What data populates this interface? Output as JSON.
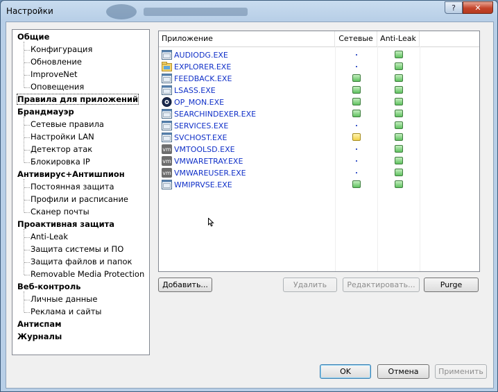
{
  "window": {
    "title": "Настройки"
  },
  "tree": {
    "items": [
      {
        "label": "Общие",
        "kind": "cat"
      },
      {
        "label": "Конфигурация",
        "kind": "sub"
      },
      {
        "label": "Обновление",
        "kind": "sub"
      },
      {
        "label": "ImproveNet",
        "kind": "sub"
      },
      {
        "label": "Оповещения",
        "kind": "sub"
      },
      {
        "label": "Правила для приложений",
        "kind": "cat",
        "selected": true
      },
      {
        "label": "Брандмауэр",
        "kind": "cat"
      },
      {
        "label": "Сетевые правила",
        "kind": "sub"
      },
      {
        "label": "Настройки LAN",
        "kind": "sub"
      },
      {
        "label": "Детектор атак",
        "kind": "sub"
      },
      {
        "label": "Блокировка IP",
        "kind": "sub"
      },
      {
        "label": "Антивирус+Антишпион",
        "kind": "cat"
      },
      {
        "label": "Постоянная защита",
        "kind": "sub"
      },
      {
        "label": "Профили и расписание",
        "kind": "sub"
      },
      {
        "label": "Сканер почты",
        "kind": "sub"
      },
      {
        "label": "Проактивная защита",
        "kind": "cat"
      },
      {
        "label": "Anti-Leak",
        "kind": "sub"
      },
      {
        "label": "Защита системы и ПО",
        "kind": "sub"
      },
      {
        "label": "Защита файлов и папок",
        "kind": "sub"
      },
      {
        "label": "Removable Media Protection",
        "kind": "sub"
      },
      {
        "label": "Веб-контроль",
        "kind": "cat"
      },
      {
        "label": "Личные данные",
        "kind": "sub"
      },
      {
        "label": "Реклама и сайты",
        "kind": "sub"
      },
      {
        "label": "Антиспам",
        "kind": "cat"
      },
      {
        "label": "Журналы",
        "kind": "cat"
      }
    ]
  },
  "apps": {
    "columns": {
      "app": "Приложение",
      "network": "Сетевые",
      "antileak": "Anti-Leak"
    },
    "rows": [
      {
        "name": "AUDIODG.EXE",
        "icon": "window-app-icon",
        "network": "none",
        "antileak": "allow"
      },
      {
        "name": "EXPLORER.EXE",
        "icon": "explorer-icon",
        "network": "none",
        "antileak": "allow"
      },
      {
        "name": "FEEDBACK.EXE",
        "icon": "window-app-icon",
        "network": "allow",
        "antileak": "allow"
      },
      {
        "name": "LSASS.EXE",
        "icon": "window-app-icon",
        "network": "allow",
        "antileak": "allow"
      },
      {
        "name": "OP_MON.EXE",
        "icon": "outpost-monitor-icon",
        "network": "allow",
        "antileak": "allow"
      },
      {
        "name": "SEARCHINDEXER.EXE",
        "icon": "window-app-icon",
        "network": "allow",
        "antileak": "allow"
      },
      {
        "name": "SERVICES.EXE",
        "icon": "window-app-icon",
        "network": "none",
        "antileak": "allow"
      },
      {
        "name": "SVCHOST.EXE",
        "icon": "window-app-icon",
        "network": "partial",
        "antileak": "allow"
      },
      {
        "name": "VMTOOLSD.EXE",
        "icon": "vmware-icon",
        "network": "none",
        "antileak": "allow"
      },
      {
        "name": "VMWARETRAY.EXE",
        "icon": "vmware-icon",
        "network": "none",
        "antileak": "allow"
      },
      {
        "name": "VMWAREUSER.EXE",
        "icon": "vmware-icon",
        "network": "none",
        "antileak": "allow"
      },
      {
        "name": "WMIPRVSE.EXE",
        "icon": "window-app-icon",
        "network": "allow",
        "antileak": "allow"
      }
    ]
  },
  "buttons": {
    "add": "Добавить...",
    "delete": "Удалить",
    "edit": "Редактировать...",
    "purge": "Purge",
    "ok": "OK",
    "cancel": "Отмена",
    "apply": "Применить"
  },
  "colors": {
    "allow": "#5fc25f",
    "partial": "#f2d24a",
    "link": "#1030c8"
  }
}
